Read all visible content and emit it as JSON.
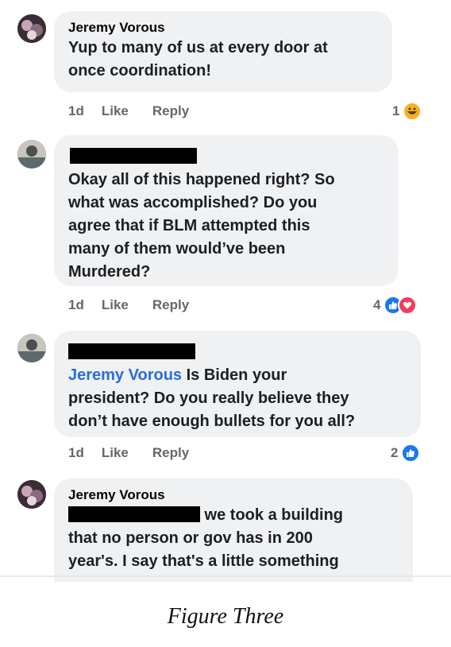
{
  "comments": [
    {
      "author": "Jeremy Vorous",
      "text": "Yup to many of us at every door at once coordination!",
      "line1": "Yup to many of us at every door at",
      "line2": "once coordination!",
      "time": "1d",
      "like": "Like",
      "reply": "Reply",
      "reaction_count": "1",
      "reactions": [
        "haha-icon"
      ]
    },
    {
      "author": "[redacted]",
      "line1": "Okay all of this happened right? So",
      "line2": "what was accomplished? Do you",
      "line3": "agree that if BLM attempted this",
      "line4": "many of them would’ve been",
      "line5": "Murdered?",
      "time": "1d",
      "like": "Like",
      "reply": "Reply",
      "reaction_count": "4",
      "reactions": [
        "like-icon",
        "love-icon"
      ]
    },
    {
      "author": "[redacted]",
      "mention": "Jeremy Vorous",
      "line1_rest": " Is Biden your",
      "line2": "president? Do you really believe they",
      "line3": "don’t have enough bullets for you all?",
      "time": "1d",
      "like": "Like",
      "reply": "Reply",
      "reaction_count": "2",
      "reactions": [
        "like-icon"
      ]
    },
    {
      "author": "Jeremy Vorous",
      "line1_rest": " we took a building",
      "line2": "that no person or gov has  in 200",
      "line3": "year's. I say that's a little something"
    }
  ],
  "caption": "Figure Three",
  "colors": {
    "bubble": "#eff1f3",
    "meta": "#65676b",
    "mention": "#2d6cd8",
    "like": "#1877f2",
    "love": "#f33e58",
    "haha": "#f7b125"
  }
}
